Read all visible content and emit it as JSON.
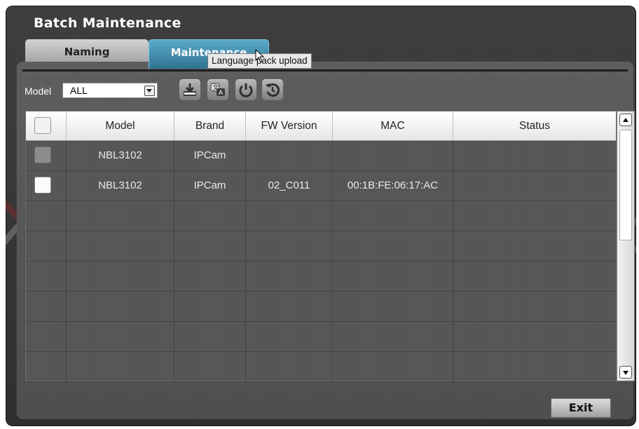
{
  "window": {
    "title": "Batch Maintenance"
  },
  "tabs": [
    {
      "label": "Naming",
      "active": false
    },
    {
      "label": "Maintenance",
      "active": true
    }
  ],
  "tooltip": "Language pack upload",
  "filter": {
    "label": "Model",
    "selected": "ALL"
  },
  "toolbar": {
    "icons": [
      "firmware-upgrade-icon",
      "language-pack-upload-icon",
      "reboot-icon",
      "factory-reset-icon"
    ]
  },
  "table": {
    "columns": [
      "",
      "Model",
      "Brand",
      "FW Version",
      "MAC",
      "Status"
    ],
    "rows": [
      {
        "checked_style": "disabled",
        "model": "NBL3102",
        "brand": "IPCam",
        "fw_version": "",
        "mac": "",
        "status": ""
      },
      {
        "checked_style": "unchecked",
        "model": "NBL3102",
        "brand": "IPCam",
        "fw_version": "02_C011",
        "mac": "00:1B:FE:06:17:AC",
        "status": ""
      }
    ],
    "empty_rows": 6
  },
  "buttons": {
    "exit": "Exit"
  },
  "colors": {
    "active_tab": "#3d8fb1",
    "panel": "#555555",
    "header": "#f2f2f2"
  }
}
